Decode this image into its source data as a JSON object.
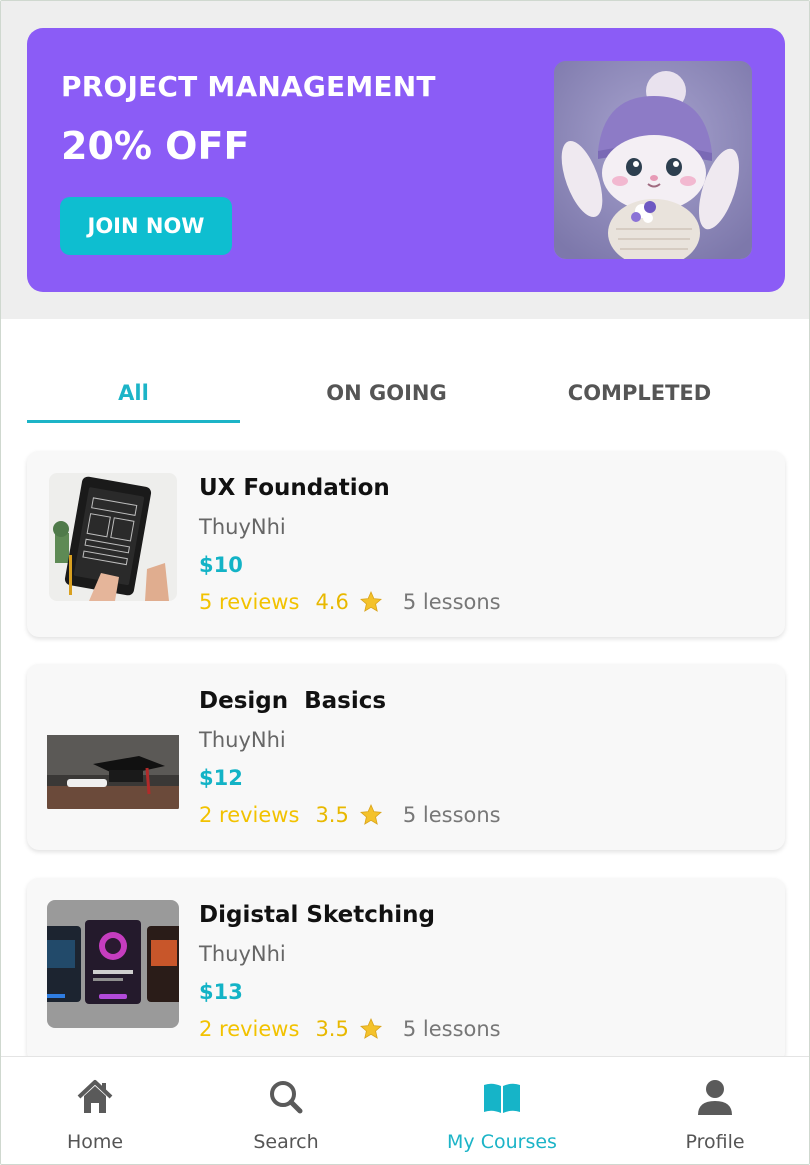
{
  "banner": {
    "title": "PROJECT MANAGEMENT",
    "discount": "20% OFF",
    "cta_label": "JOIN NOW",
    "image_icon": "bunny-illustration"
  },
  "tabs": [
    {
      "label": "All",
      "active": true
    },
    {
      "label": "ON GOING",
      "active": false
    },
    {
      "label": "COMPLETED",
      "active": false
    }
  ],
  "courses": [
    {
      "title": "UX Foundation",
      "author": "ThuyNhi",
      "price": "$10",
      "reviews": "5 reviews",
      "rating": "4.6",
      "lessons": "5 lessons",
      "thumb_icon": "tablet-wireframe-image"
    },
    {
      "title": "Design  Basics",
      "author": "ThuyNhi",
      "price": "$12",
      "reviews": "2 reviews",
      "rating": "3.5",
      "lessons": "5 lessons",
      "thumb_icon": "graduation-cap-image"
    },
    {
      "title": "Digistal Sketching",
      "author": "ThuyNhi",
      "price": "$13",
      "reviews": "2 reviews",
      "rating": "3.5",
      "lessons": "5 lessons",
      "thumb_icon": "app-cards-image"
    }
  ],
  "nav": [
    {
      "label": "Home",
      "icon": "home-icon",
      "active": false
    },
    {
      "label": "Search",
      "icon": "search-icon",
      "active": false
    },
    {
      "label": "My Courses",
      "icon": "book-icon",
      "active": true
    },
    {
      "label": "Profile",
      "icon": "user-icon",
      "active": false
    }
  ],
  "colors": {
    "banner": "#8b5cf6",
    "accent": "#1cb4c7",
    "rating": "#f2c200"
  }
}
